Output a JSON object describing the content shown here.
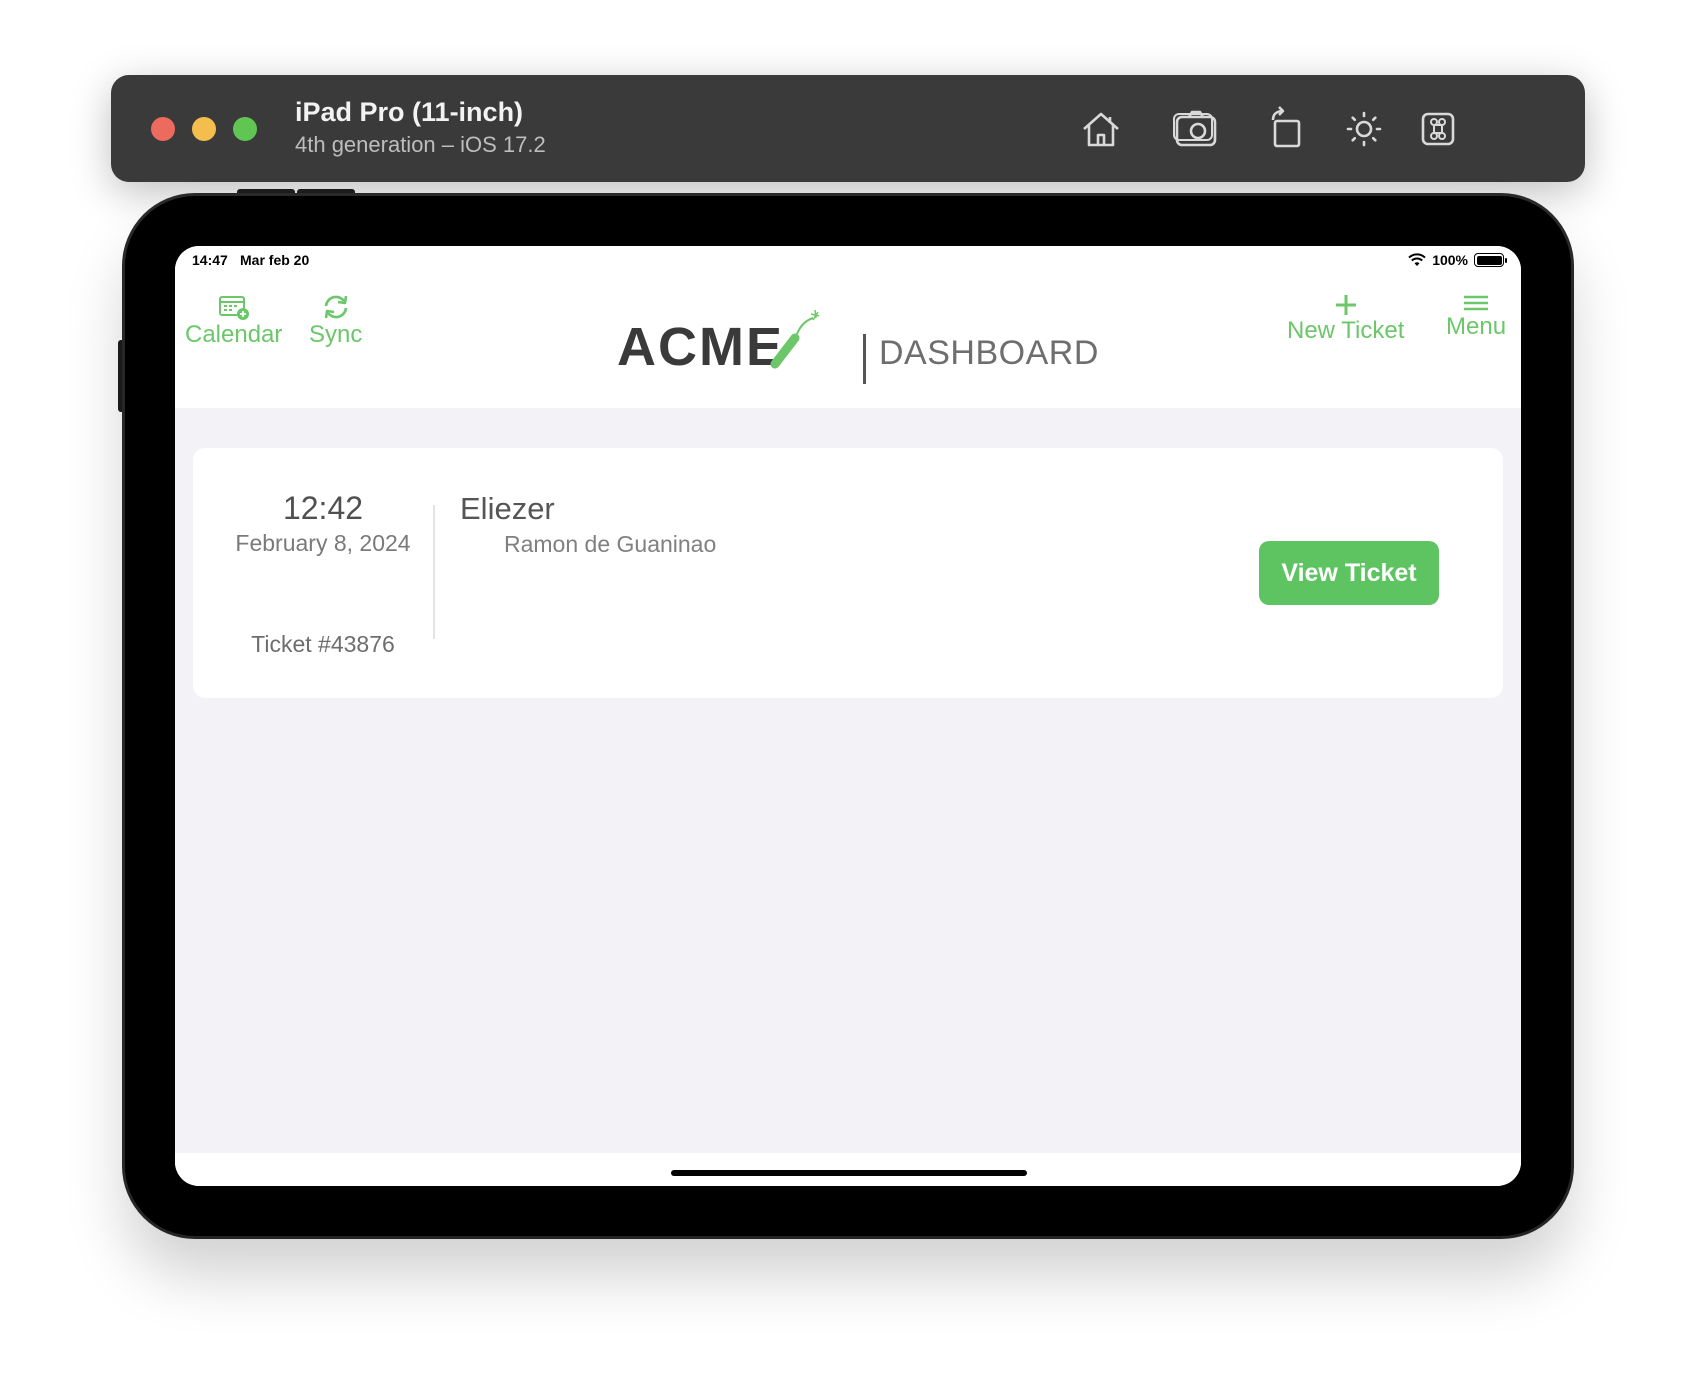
{
  "simulator": {
    "title": "iPad Pro (11-inch)",
    "subtitle": "4th generation – iOS 17.2",
    "tools": [
      "home-icon",
      "screenshot-icon",
      "rotate-icon",
      "appearance-icon",
      "command-icon"
    ]
  },
  "status_bar": {
    "time": "14:47",
    "date": "Mar feb 20",
    "battery": "100%"
  },
  "nav": {
    "calendar_label": "Calendar",
    "sync_label": "Sync",
    "logo_text": "ACME",
    "page_title": "DASHBOARD",
    "new_ticket_label": "New Ticket",
    "menu_label": "Menu",
    "accent_color": "#6cc76a"
  },
  "tickets": [
    {
      "time": "12:42",
      "date": "February 8, 2024",
      "ticket_number": "Ticket #43876",
      "customer": "Eliezer",
      "location": "Ramon de Guaninao",
      "action_label": "View Ticket"
    }
  ]
}
